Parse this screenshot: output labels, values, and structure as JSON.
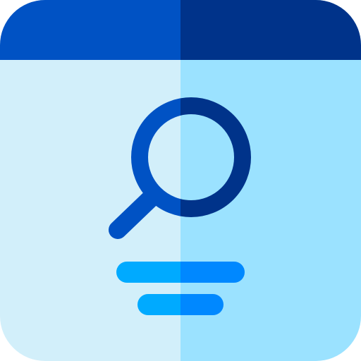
{
  "icon": {
    "name": "search-window-icon",
    "colors": {
      "header_left": "#0052C4",
      "header_right": "#00338A",
      "body_left": "#D2EFFA",
      "body_right": "#9BE2FF",
      "lens_left": "#0052C4",
      "lens_right": "#00338A",
      "line_left": "#00AAFF",
      "line_right": "#0088FF"
    }
  }
}
